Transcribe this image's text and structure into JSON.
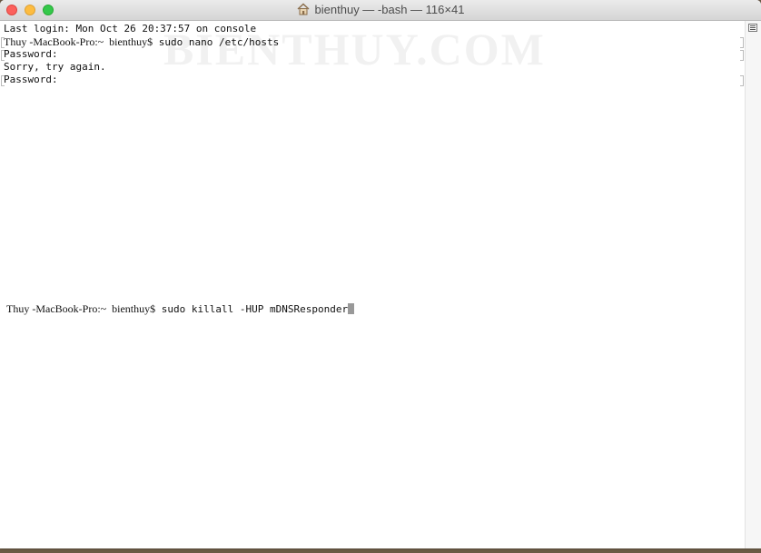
{
  "window": {
    "title": "bienthuy — -bash — 116×41",
    "watermark": "BIENTHUY.COM"
  },
  "terminal": {
    "lines": [
      "Last login: Mon Oct 26 20:37:57 on console",
      "sudo nano /etc/hosts",
      "Password:",
      "Sorry, try again.",
      "Password:"
    ],
    "prompt_host_1": "Thuy -MacBook-Pro:~  bienthuy$",
    "prompt_host_2": "Thuy -MacBook-Pro:~  bienthuy$",
    "current_command": "sudo killall -HUP mDNSResponder"
  },
  "icons": {
    "title_icon": "home-icon",
    "scroll_icon": "scroll-menu-icon"
  }
}
